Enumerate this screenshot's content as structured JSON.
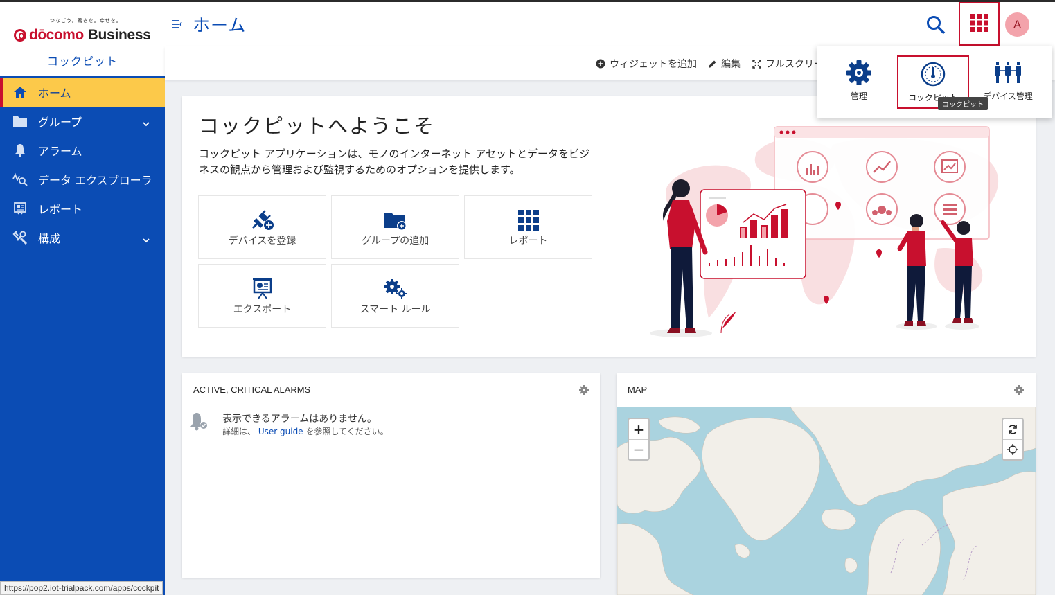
{
  "brand": {
    "tagline": "つなごう。驚きを。幸せを。",
    "name_main": "dōcomo",
    "name_sub": "Business",
    "app_name": "コックピット"
  },
  "sidebar": {
    "items": [
      {
        "label": "ホーム",
        "icon": "home-icon"
      },
      {
        "label": "グループ",
        "icon": "folder-icon",
        "chevron": true
      },
      {
        "label": "アラーム",
        "icon": "bell-icon"
      },
      {
        "label": "データ エクスプローラ",
        "icon": "data-explorer-icon"
      },
      {
        "label": "レポート",
        "icon": "report-icon"
      },
      {
        "label": "構成",
        "icon": "settings-icon",
        "chevron": true
      }
    ]
  },
  "header": {
    "title": "ホーム",
    "avatar_initial": "A"
  },
  "actions": {
    "add_widget": "ウィジェットを追加",
    "edit": "編集",
    "fullscreen": "フルスクリー"
  },
  "app_switcher": {
    "apps": [
      {
        "label": "管理",
        "icon": "gear-icon"
      },
      {
        "label": "コックピット",
        "icon": "gauge-icon",
        "selected": true
      },
      {
        "label": "デバイス管理",
        "icon": "device-management-icon"
      }
    ],
    "tooltip": "コックピット"
  },
  "welcome": {
    "title": "コックピットへようこそ",
    "description": "コックピット アプリケーションは、モノのインターネット アセットとデータをビジネスの観点から管理および監視するためのオプションを提供します。",
    "tiles": [
      {
        "label": "デバイスを登録",
        "icon": "plug-add-icon"
      },
      {
        "label": "グループの追加",
        "icon": "folder-add-icon"
      },
      {
        "label": "レポート",
        "icon": "grid-icon"
      },
      {
        "label": "エクスポート",
        "icon": "presentation-icon"
      },
      {
        "label": "スマート ルール",
        "icon": "gears-icon"
      }
    ]
  },
  "alarms_widget": {
    "title": "ACTIVE, CRITICAL ALARMS",
    "empty_title": "表示できるアラームはありません。",
    "empty_prefix": "詳細は、",
    "empty_link": "User guide",
    "empty_suffix": "を参照してください。"
  },
  "map_widget": {
    "title": "MAP",
    "zoom_in": "+",
    "zoom_out": "−"
  },
  "status_bar": {
    "url": "https://pop2.iot-trialpack.com/apps/cockpit"
  },
  "colors": {
    "sidebar": "#0b4cb4",
    "active": "#fcc94a",
    "accent": "#c8102e",
    "map_water": "#aad3df",
    "map_land": "#f2efe9"
  }
}
